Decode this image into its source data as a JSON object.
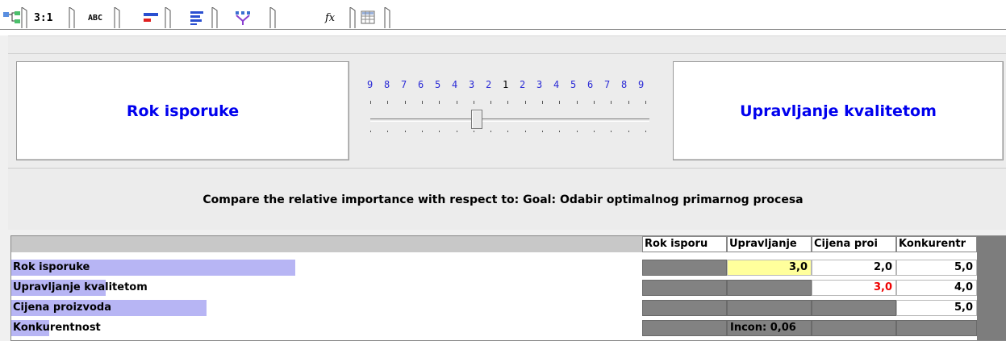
{
  "tabs": [
    {
      "icon": "hierarchy-icon",
      "label": ""
    },
    {
      "icon": "ratio-icon",
      "label": "3:1"
    },
    {
      "icon": "abc-icon",
      "label": "ABC"
    },
    {
      "icon": "horizontal-bars-icon",
      "label": ""
    },
    {
      "icon": "bar-list-icon",
      "label": ""
    },
    {
      "icon": "funnel-icon",
      "label": ""
    },
    {
      "icon": "formula-icon",
      "label": "fx"
    },
    {
      "icon": "grid-icon",
      "label": ""
    }
  ],
  "comparison": {
    "left_label": "Rok isporuke",
    "right_label": "Upravljanje kvalitetom",
    "scale": [
      "9",
      "8",
      "7",
      "6",
      "5",
      "4",
      "3",
      "2",
      "1",
      "2",
      "3",
      "4",
      "5",
      "6",
      "7",
      "8",
      "9"
    ],
    "slider_value": 3,
    "slider_side": "left"
  },
  "compare_text": "Compare the relative importance with respect to: Goal: Odabir optimalnog primarnog procesa",
  "matrix": {
    "columns": [
      "Rok isporu",
      "Upravljanje",
      "Cijena proi",
      "Konkurentr"
    ],
    "rows": [
      {
        "label": "Rok isporuke",
        "priority": 0.45,
        "cells": [
          "",
          "3,0",
          "2,0",
          "5,0"
        ]
      },
      {
        "label": "Upravljanje kvalitetom",
        "priority": 0.15,
        "cells": [
          "",
          "",
          "3,0",
          "4,0"
        ]
      },
      {
        "label": "Cijena proizvoda",
        "priority": 0.31,
        "cells": [
          "",
          "",
          "",
          "5,0"
        ]
      },
      {
        "label": "Konkurentnost",
        "priority": 0.06,
        "cells": [
          "",
          "Incon: 0,06",
          "",
          ""
        ]
      }
    ],
    "selected_cell": "Rok isporuke / Upravljanje kvalitetom",
    "red_value_color": "#ee0000",
    "selected_color": "#ffff9c",
    "bar_color": "#b7b5f4",
    "accent_text_color": "#0000ee"
  }
}
